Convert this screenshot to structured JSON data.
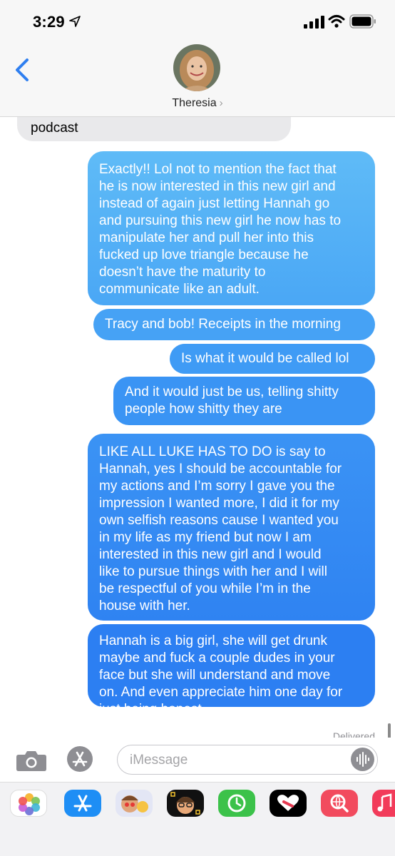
{
  "status_bar": {
    "time": "3:29"
  },
  "header": {
    "contact_name": "Theresia",
    "chevron": "›"
  },
  "messages": [
    {
      "direction": "incoming",
      "text": "podcast"
    },
    {
      "direction": "outgoing",
      "text": "Exactly!! Lol not to mention the fact that\nhe is now interested in this new girl and\ninstead of again just letting Hannah go\nand pursuing this new girl he now has to\nmanipulate her and pull her into this\nfucked up love triangle because he\ndoesn’t have the maturity to\ncommunicate like an adult."
    },
    {
      "direction": "outgoing",
      "text": "Tracy and bob! Receipts in the morning"
    },
    {
      "direction": "outgoing",
      "text": "Is what it would be called lol"
    },
    {
      "direction": "outgoing",
      "text": "And it would just be us, telling shitty\npeople how shitty they are"
    },
    {
      "direction": "outgoing",
      "text": "LIKE ALL LUKE HAS TO DO is say to\nHannah, yes I should be accountable for\nmy actions and I’m sorry I gave you the\nimpression I wanted more, I did it for my\nown selfish reasons cause I wanted you\nin my life as my friend but now I am\ninterested in this new girl and I would\nlike to pursue things with her and I will\nbe respectful of you while I’m in the\nhouse with her."
    },
    {
      "direction": "outgoing",
      "text": "Hannah is a big girl, she will get drunk\nmaybe and fuck a couple dudes in your\nface but she will understand and move\non. And even appreciate him one day for\njust being honest"
    }
  ],
  "delivery_status": "Delivered",
  "composer": {
    "placeholder": "iMessage"
  },
  "icons": {
    "status": [
      "location-arrow-icon",
      "signal-icon",
      "wifi-icon",
      "battery-icon"
    ],
    "composer": [
      "camera-icon",
      "app-store-icon",
      "audio-waveform-icon"
    ],
    "app_strip": [
      "photos-app-icon",
      "app-store-app-icon",
      "memoji-stickers-icon",
      "memoji-icon",
      "activity-app-icon",
      "digital-touch-icon",
      "web-search-icon",
      "music-app-icon"
    ]
  },
  "colors": {
    "incoming_bubble": "#e9e9eb",
    "outgoing_bubble_top": "#5fbbf7",
    "outgoing_bubble_bottom": "#2c7ff2",
    "accent": "#2f7ff0"
  }
}
